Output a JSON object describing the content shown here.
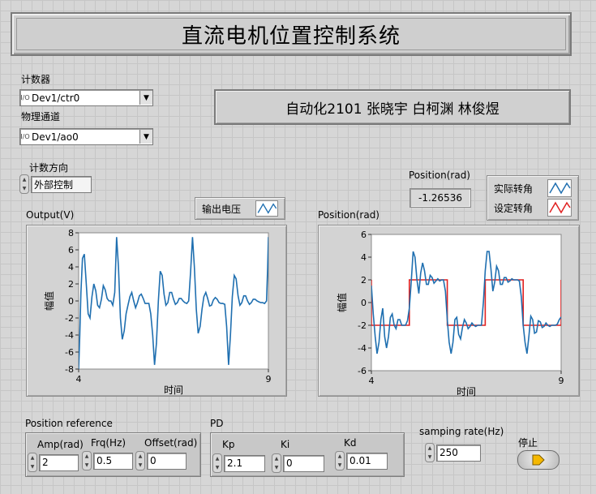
{
  "title": "直流电机位置控制系统",
  "names": "自动化2101 张晓宇 白柯渊 林俊煜",
  "counter": {
    "label": "计数器",
    "value": "Dev1/ctr0"
  },
  "channel": {
    "label": "物理通道",
    "value": "Dev1/ao0"
  },
  "direction": {
    "label": "计数方向",
    "value": "外部控制"
  },
  "io_badge": "I/O",
  "position_indicator": {
    "label": "Position(rad)",
    "value": "-1.26536"
  },
  "legend_output": {
    "label": "输出电压",
    "color": "#1f6fb0"
  },
  "legend_position": [
    {
      "label": "实际转角",
      "color": "#1f6fb0"
    },
    {
      "label": "设定转角",
      "color": "#e02020"
    }
  ],
  "position_reference": {
    "label": "Position reference",
    "amp": {
      "label": "Amp(rad)",
      "value": "2"
    },
    "frq": {
      "label": "Frq(Hz)",
      "value": "0.5"
    },
    "offset": {
      "label": "Offset(rad)",
      "value": "0"
    }
  },
  "pd": {
    "label": "PD",
    "kp": {
      "label": "Kp",
      "value": "2.1"
    },
    "ki": {
      "label": "Ki",
      "value": "0"
    },
    "kd": {
      "label": "Kd",
      "value": "0.01"
    }
  },
  "sampling": {
    "label": "samping rate(Hz)",
    "value": "250"
  },
  "stop": {
    "label": "停止",
    "color": "#f5b800"
  },
  "chart_data": [
    {
      "type": "line",
      "title": "Output(V)",
      "xlabel": "时间",
      "ylabel": "幅值",
      "xlim": [
        4,
        9
      ],
      "ylim": [
        -8,
        8
      ],
      "yticks": [
        -8,
        -6,
        -4,
        -2,
        0,
        2,
        4,
        6,
        8
      ],
      "xticks": [
        4,
        9
      ],
      "series": [
        {
          "name": "输出电压",
          "color": "#1f6fb0",
          "x": [
            4.0,
            4.03,
            4.06,
            4.1,
            4.15,
            4.2,
            4.25,
            4.3,
            4.35,
            4.4,
            4.45,
            4.5,
            4.55,
            4.6,
            4.65,
            4.7,
            4.75,
            4.8,
            4.85,
            4.9,
            4.95,
            5.0,
            5.05,
            5.1,
            5.15,
            5.2,
            5.25,
            5.3,
            5.35,
            5.4,
            5.45,
            5.5,
            5.55,
            5.6,
            5.65,
            5.7,
            5.75,
            5.8,
            5.85,
            5.9,
            5.95,
            6.0,
            6.05,
            6.1,
            6.15,
            6.2,
            6.25,
            6.3,
            6.35,
            6.4,
            6.45,
            6.5,
            6.55,
            6.6,
            6.65,
            6.7,
            6.75,
            6.8,
            6.85,
            6.9,
            6.95,
            7.0,
            7.05,
            7.1,
            7.15,
            7.2,
            7.25,
            7.3,
            7.35,
            7.4,
            7.45,
            7.5,
            7.55,
            7.6,
            7.65,
            7.7,
            7.75,
            7.8,
            7.85,
            7.9,
            7.95,
            8.0,
            8.05,
            8.1,
            8.15,
            8.2,
            8.25,
            8.3,
            8.35,
            8.4,
            8.45,
            8.5,
            8.55,
            8.6,
            8.65,
            8.7,
            8.75,
            8.8,
            8.85,
            8.9,
            8.95,
            8.98,
            9.0
          ],
          "y": [
            -8.0,
            -4.0,
            1.0,
            5.0,
            5.5,
            2.0,
            -1.5,
            -2.0,
            0.5,
            2.0,
            1.2,
            -0.5,
            -0.8,
            0.2,
            1.8,
            1.3,
            0.3,
            0.0,
            0.0,
            -0.5,
            1.0,
            7.5,
            4.0,
            -2.0,
            -4.5,
            -3.5,
            -1.5,
            -0.5,
            0.5,
            1.0,
            0.0,
            -0.8,
            -0.2,
            0.6,
            0.8,
            0.3,
            -0.3,
            -0.3,
            -0.3,
            -1.5,
            -4.0,
            -7.5,
            -5.0,
            0.0,
            3.5,
            3.0,
            0.8,
            -0.5,
            -0.2,
            1.0,
            1.0,
            0.2,
            -0.4,
            -0.2,
            0.3,
            0.3,
            0.0,
            -0.2,
            -0.3,
            0.0,
            3.5,
            7.5,
            4.0,
            -1.0,
            -3.8,
            -3.0,
            -1.0,
            0.5,
            1.0,
            0.3,
            -0.6,
            -0.5,
            0.1,
            0.4,
            0.2,
            -0.2,
            -0.3,
            -0.3,
            -0.4,
            -3.0,
            -7.5,
            -4.0,
            0.5,
            3.0,
            2.6,
            0.6,
            -0.5,
            -0.2,
            0.6,
            0.6,
            0.0,
            -0.4,
            -0.2,
            0.2,
            0.2,
            0.0,
            -0.1,
            -0.2,
            -0.2,
            -0.3,
            0.0,
            4.0,
            7.5
          ]
        }
      ]
    },
    {
      "type": "line",
      "title": "Position(rad)",
      "xlabel": "时间",
      "ylabel": "幅值",
      "xlim": [
        4,
        9
      ],
      "ylim": [
        -6,
        6
      ],
      "yticks": [
        -6,
        -4,
        -2,
        0,
        2,
        4,
        6
      ],
      "xticks": [
        4,
        9
      ],
      "series": [
        {
          "name": "实际转角",
          "color": "#1f6fb0",
          "x": [
            4.0,
            4.05,
            4.1,
            4.15,
            4.2,
            4.25,
            4.3,
            4.35,
            4.4,
            4.45,
            4.5,
            4.55,
            4.6,
            4.65,
            4.7,
            4.75,
            4.8,
            4.85,
            4.9,
            4.95,
            5.0,
            5.05,
            5.1,
            5.15,
            5.2,
            5.25,
            5.3,
            5.35,
            5.4,
            5.45,
            5.5,
            5.55,
            5.6,
            5.65,
            5.7,
            5.75,
            5.8,
            5.85,
            5.9,
            5.95,
            6.0,
            6.05,
            6.1,
            6.15,
            6.2,
            6.25,
            6.3,
            6.35,
            6.4,
            6.45,
            6.5,
            6.55,
            6.6,
            6.65,
            6.7,
            6.75,
            6.8,
            6.85,
            6.9,
            6.95,
            7.0,
            7.05,
            7.1,
            7.15,
            7.2,
            7.25,
            7.3,
            7.35,
            7.4,
            7.45,
            7.5,
            7.55,
            7.6,
            7.65,
            7.7,
            7.75,
            7.8,
            7.85,
            7.9,
            7.95,
            8.0,
            8.05,
            8.1,
            8.15,
            8.2,
            8.25,
            8.3,
            8.35,
            8.4,
            8.45,
            8.5,
            8.55,
            8.6,
            8.65,
            8.7,
            8.75,
            8.8,
            8.85,
            8.9,
            8.95,
            9.0
          ],
          "y": [
            1.5,
            -1.0,
            -3.0,
            -4.5,
            -3.5,
            -1.5,
            -0.5,
            -3.0,
            -4.0,
            -3.0,
            -1.3,
            -1.0,
            -2.0,
            -2.3,
            -1.5,
            -1.5,
            -2.0,
            -2.0,
            -2.0,
            -1.6,
            -0.5,
            1.8,
            4.5,
            4.0,
            2.0,
            0.8,
            2.6,
            3.5,
            2.8,
            1.6,
            1.6,
            2.4,
            2.2,
            1.7,
            1.9,
            2.1,
            1.9,
            2.0,
            2.0,
            1.0,
            -1.5,
            -3.5,
            -4.5,
            -3.5,
            -1.5,
            -1.3,
            -2.8,
            -3.2,
            -2.2,
            -1.5,
            -1.8,
            -2.3,
            -2.1,
            -1.8,
            -2.0,
            -2.1,
            -2.0,
            -2.0,
            -2.0,
            0.0,
            2.8,
            4.5,
            4.5,
            3.0,
            1.0,
            1.8,
            3.2,
            2.8,
            1.6,
            1.6,
            2.2,
            2.2,
            1.8,
            1.9,
            2.1,
            2.0,
            2.0,
            2.0,
            1.9,
            0.5,
            -2.0,
            -3.5,
            -4.5,
            -3.0,
            -1.2,
            -1.5,
            -2.7,
            -2.6,
            -1.6,
            -1.7,
            -2.2,
            -2.1,
            -1.8,
            -2.0,
            -2.1,
            -2.0,
            -2.0,
            -2.0,
            -1.9,
            -1.5,
            -1.27
          ]
        },
        {
          "name": "设定转角",
          "color": "#e02020",
          "x": [
            4.0,
            4.0,
            5.0,
            5.0,
            6.0,
            6.0,
            7.0,
            7.0,
            8.0,
            8.0,
            9.0,
            9.0
          ],
          "y": [
            2,
            -2,
            -2,
            2,
            2,
            -2,
            -2,
            2,
            2,
            -2,
            -2,
            2
          ]
        }
      ]
    }
  ]
}
